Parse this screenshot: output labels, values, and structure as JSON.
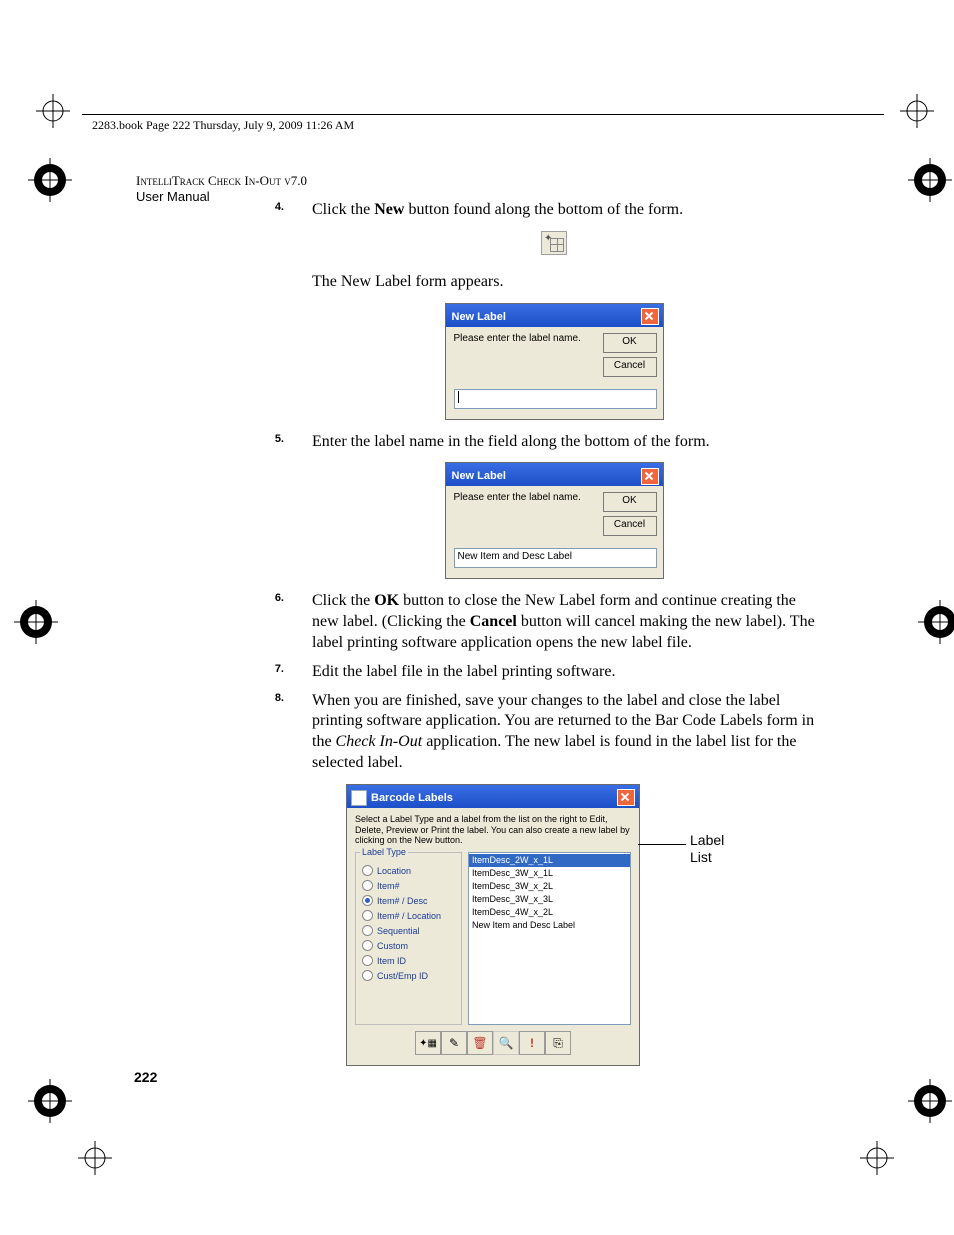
{
  "header_bar": "2283.book  Page 222  Thursday, July 9, 2009  11:26 AM",
  "doc_title": "IntelliTrack Check In-Out v7.0",
  "doc_subtitle": "User Manual",
  "page_number": "222",
  "steps": {
    "s4": {
      "num": "4.",
      "pre": "Click the ",
      "bold1": "New",
      "post": " button found along the bottom of the form."
    },
    "s4b": "The New Label form appears.",
    "s5": {
      "num": "5.",
      "text": "Enter the label name in the field along the bottom of the form."
    },
    "s6": {
      "num": "6.",
      "a": "Click the ",
      "b": "OK",
      "c": " button to close the New Label form and continue creating the new label. (Clicking the ",
      "d": "Cancel",
      "e": " button will cancel making the new label). The label printing software application opens the new label file."
    },
    "s7": {
      "num": "7.",
      "text": "Edit the label file in the label printing software."
    },
    "s8": {
      "num": "8.",
      "a": "When you are finished, save your changes to the label and close the label printing software application. You are returned to the Bar Code Labels form in the ",
      "b": "Check In-Out",
      "c": " application. The new label is found in the label list for the selected label."
    }
  },
  "new_label_dialog": {
    "title": "New Label",
    "prompt": "Please enter the label name.",
    "ok": "OK",
    "cancel": "Cancel",
    "input_value2": "New Item and Desc Label"
  },
  "barcode_window": {
    "title": "Barcode Labels",
    "instructions": "Select a Label Type and a label from the list on the right to Edit, Delete, Preview or Print the label. You can also create a new label by clicking on the New button.",
    "groupbox_title": "Label Type",
    "radios": [
      "Location",
      "Item#",
      "Item# / Desc",
      "Item# / Location",
      "Sequential",
      "Custom",
      "Item ID",
      "Cust/Emp ID"
    ],
    "selected_radio_index": 2,
    "list": [
      "ItemDesc_2W_x_1L",
      "ItemDesc_3W_x_1L",
      "ItemDesc_3W_x_2L",
      "ItemDesc_3W_x_3L",
      "ItemDesc_4W_x_2L",
      "New Item and Desc Label"
    ],
    "selected_list_index": 0,
    "toolbar_icons": [
      "new-icon",
      "edit-icon",
      "delete-icon",
      "preview-icon",
      "print-icon",
      "close-icon"
    ]
  },
  "callout": {
    "line1": "Label",
    "line2": "List"
  }
}
